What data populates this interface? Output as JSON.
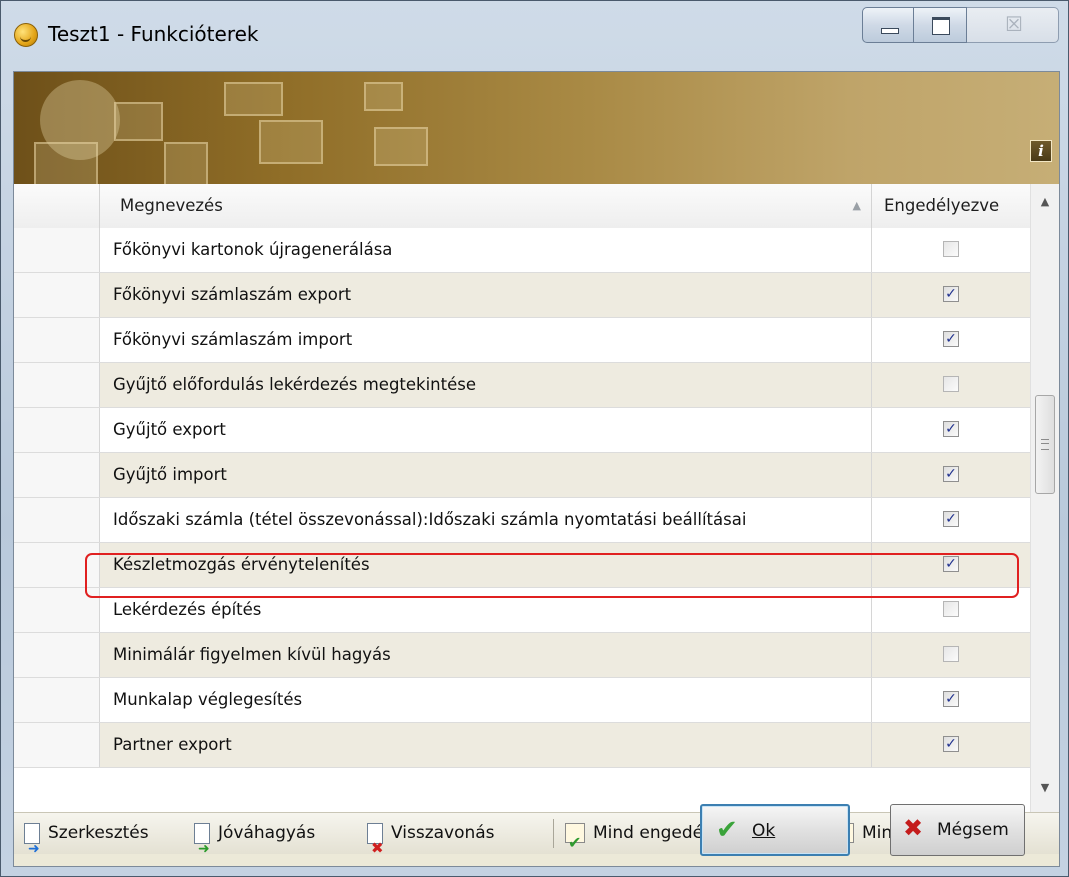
{
  "window": {
    "title": "Teszt1 - Funkcióterek",
    "controls": {
      "minimize": "minimize",
      "maximize": "maximize",
      "close": "close"
    },
    "close_glyph": "☒"
  },
  "banner": {
    "info_label": "i"
  },
  "grid": {
    "columns": {
      "name": "Megnevezés",
      "enabled": "Engedélyezve"
    },
    "sort_indicator": "▲",
    "rows": [
      {
        "name": "Főkönyvi kartonok újragenerálása",
        "enabled": false
      },
      {
        "name": "Főkönyvi számlaszám export",
        "enabled": true
      },
      {
        "name": "Főkönyvi számlaszám import",
        "enabled": true
      },
      {
        "name": "Gyűjtő előfordulás lekérdezés megtekintése",
        "enabled": false
      },
      {
        "name": "Gyűjtő export",
        "enabled": true
      },
      {
        "name": "Gyűjtő import",
        "enabled": true
      },
      {
        "name": "Időszaki számla (tétel összevonással):Időszaki számla nyomtatási beállításai",
        "enabled": true,
        "highlighted": true
      },
      {
        "name": "Készletmozgás érvénytelenítés",
        "enabled": true
      },
      {
        "name": "Lekérdezés építés",
        "enabled": false
      },
      {
        "name": "Minimálár figyelmen kívül hagyás",
        "enabled": false
      },
      {
        "name": "Munkalap véglegesítés",
        "enabled": true
      },
      {
        "name": "Partner export",
        "enabled": true
      }
    ],
    "highlight_color": "#e02020"
  },
  "scrollbar": {
    "up": "▲",
    "down": "▼"
  },
  "toolbar": {
    "edit": "Szerkesztés",
    "approve": "Jóváhagyás",
    "revoke": "Visszavonás",
    "enable_all": "Mind engedélyezve",
    "disable_all": "Mind letíltva"
  },
  "buttons": {
    "ok": "Ok",
    "cancel": "Mégsem"
  }
}
